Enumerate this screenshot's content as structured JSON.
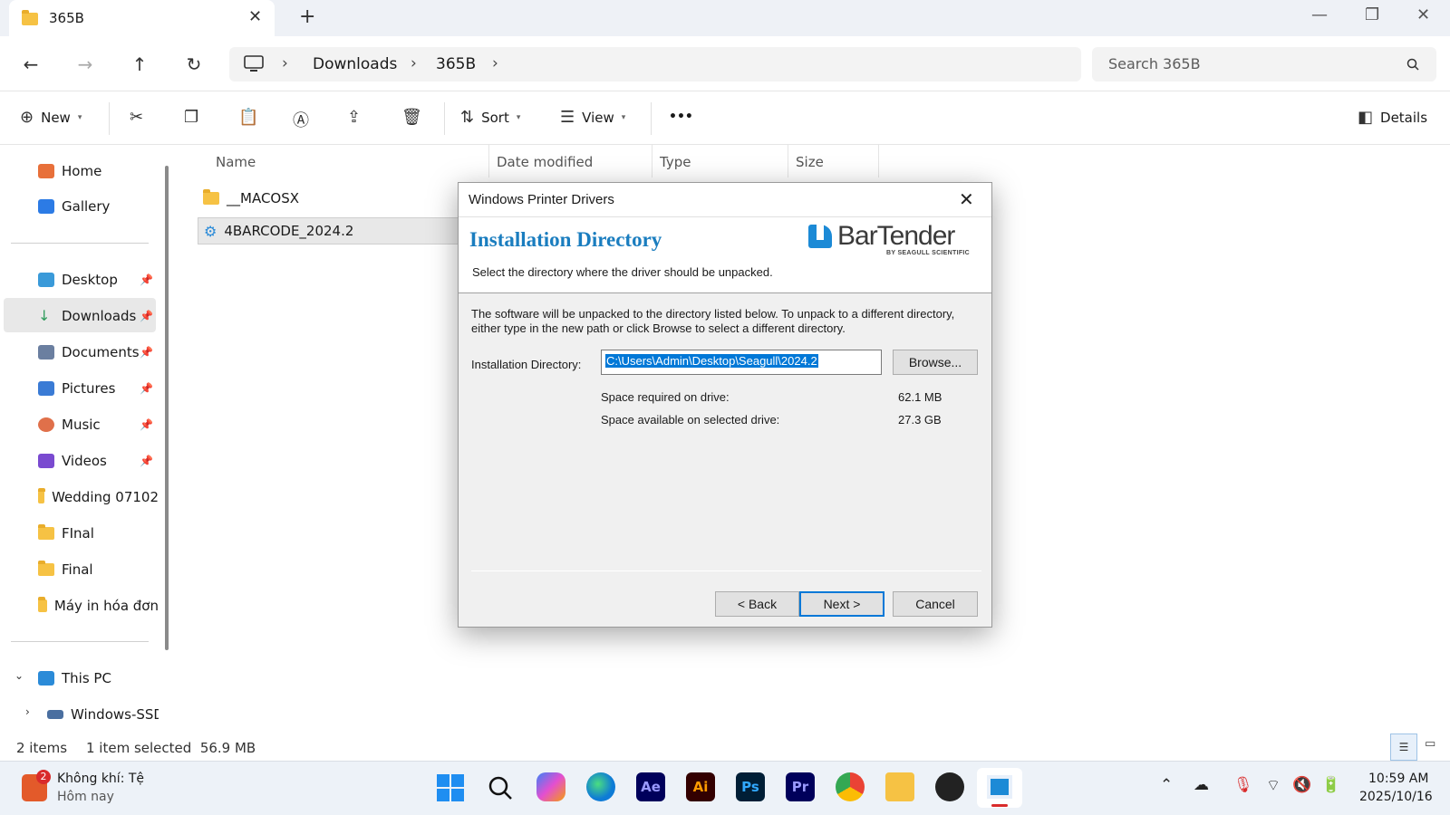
{
  "window": {
    "tab_title": "365B",
    "tab_close": "✕",
    "new_tab": "+",
    "minimize": "—",
    "restore": "❐",
    "close": "✕"
  },
  "address": {
    "back": "←",
    "forward": "→",
    "up": "↑",
    "refresh": "↻",
    "breadcrumb": [
      "Downloads",
      "365B"
    ],
    "search_placeholder": "Search 365B"
  },
  "toolbar": {
    "new_label": "New",
    "sort_label": "Sort",
    "view_label": "View",
    "more": "•••",
    "details_label": "Details"
  },
  "nav": {
    "home": "Home",
    "gallery": "Gallery",
    "quick_access": [
      {
        "label": "Desktop",
        "color": "#3a9ad9"
      },
      {
        "label": "Downloads",
        "color": "#2e9b5b"
      },
      {
        "label": "Documents",
        "color": "#6b7fa0"
      },
      {
        "label": "Pictures",
        "color": "#3a7bd5"
      },
      {
        "label": "Music",
        "color": "#e0704a"
      },
      {
        "label": "Videos",
        "color": "#7a4ad0"
      },
      {
        "label": "Wedding 07102",
        "color": "#f6c244"
      },
      {
        "label": "FInal",
        "color": "#f6c244"
      },
      {
        "label": "Final",
        "color": "#f6c244"
      },
      {
        "label": "Máy in hóa đơn",
        "color": "#f6c244"
      }
    ],
    "this_pc": "This PC",
    "drive": "Windows-SSD"
  },
  "files": {
    "columns": [
      "Name",
      "Date modified",
      "Type",
      "Size"
    ],
    "rows": [
      {
        "name": "__MACOSX",
        "selected": false
      },
      {
        "name": "4BARCODE_2024.2",
        "selected": true
      }
    ]
  },
  "status": {
    "items": "2 items",
    "selection": "1 item selected  56.9 MB"
  },
  "dialog": {
    "title": "Windows Printer Drivers",
    "heading": "Installation Directory",
    "subheading": "Select the directory where the driver should be unpacked.",
    "brand": "BarTender",
    "brand_tagline": "BY SEAGULL SCIENTIFIC",
    "description": "The software will be unpacked to the directory listed below.  To unpack to a different directory, either type in the new path or click Browse to select a different directory.",
    "dir_label": "Installation Directory:",
    "dir_value": "C:\\Users\\Admin\\Desktop\\Seagull\\2024.2",
    "browse_label": "Browse...",
    "space_required_label": "Space required on drive:",
    "space_required_value": "62.1 MB",
    "space_available_label": "Space available on selected drive:",
    "space_available_value": "27.3 GB",
    "back_label": "< Back",
    "next_label": "Next >",
    "cancel_label": "Cancel"
  },
  "taskbar": {
    "weather_title": "Không khí: Tệ",
    "weather_sub": "Hôm nay",
    "weather_badge": "2",
    "apps": [
      {
        "name": "after-effects",
        "label": "Ae",
        "bg": "#00005b",
        "fg": "#9999ff"
      },
      {
        "name": "illustrator",
        "label": "Ai",
        "bg": "#330000",
        "fg": "#ff9a00"
      },
      {
        "name": "photoshop",
        "label": "Ps",
        "bg": "#001e36",
        "fg": "#31a8ff"
      },
      {
        "name": "premiere",
        "label": "Pr",
        "bg": "#00005b",
        "fg": "#9999ff"
      }
    ],
    "time": "10:59 AM",
    "date": "2025/10/16"
  }
}
